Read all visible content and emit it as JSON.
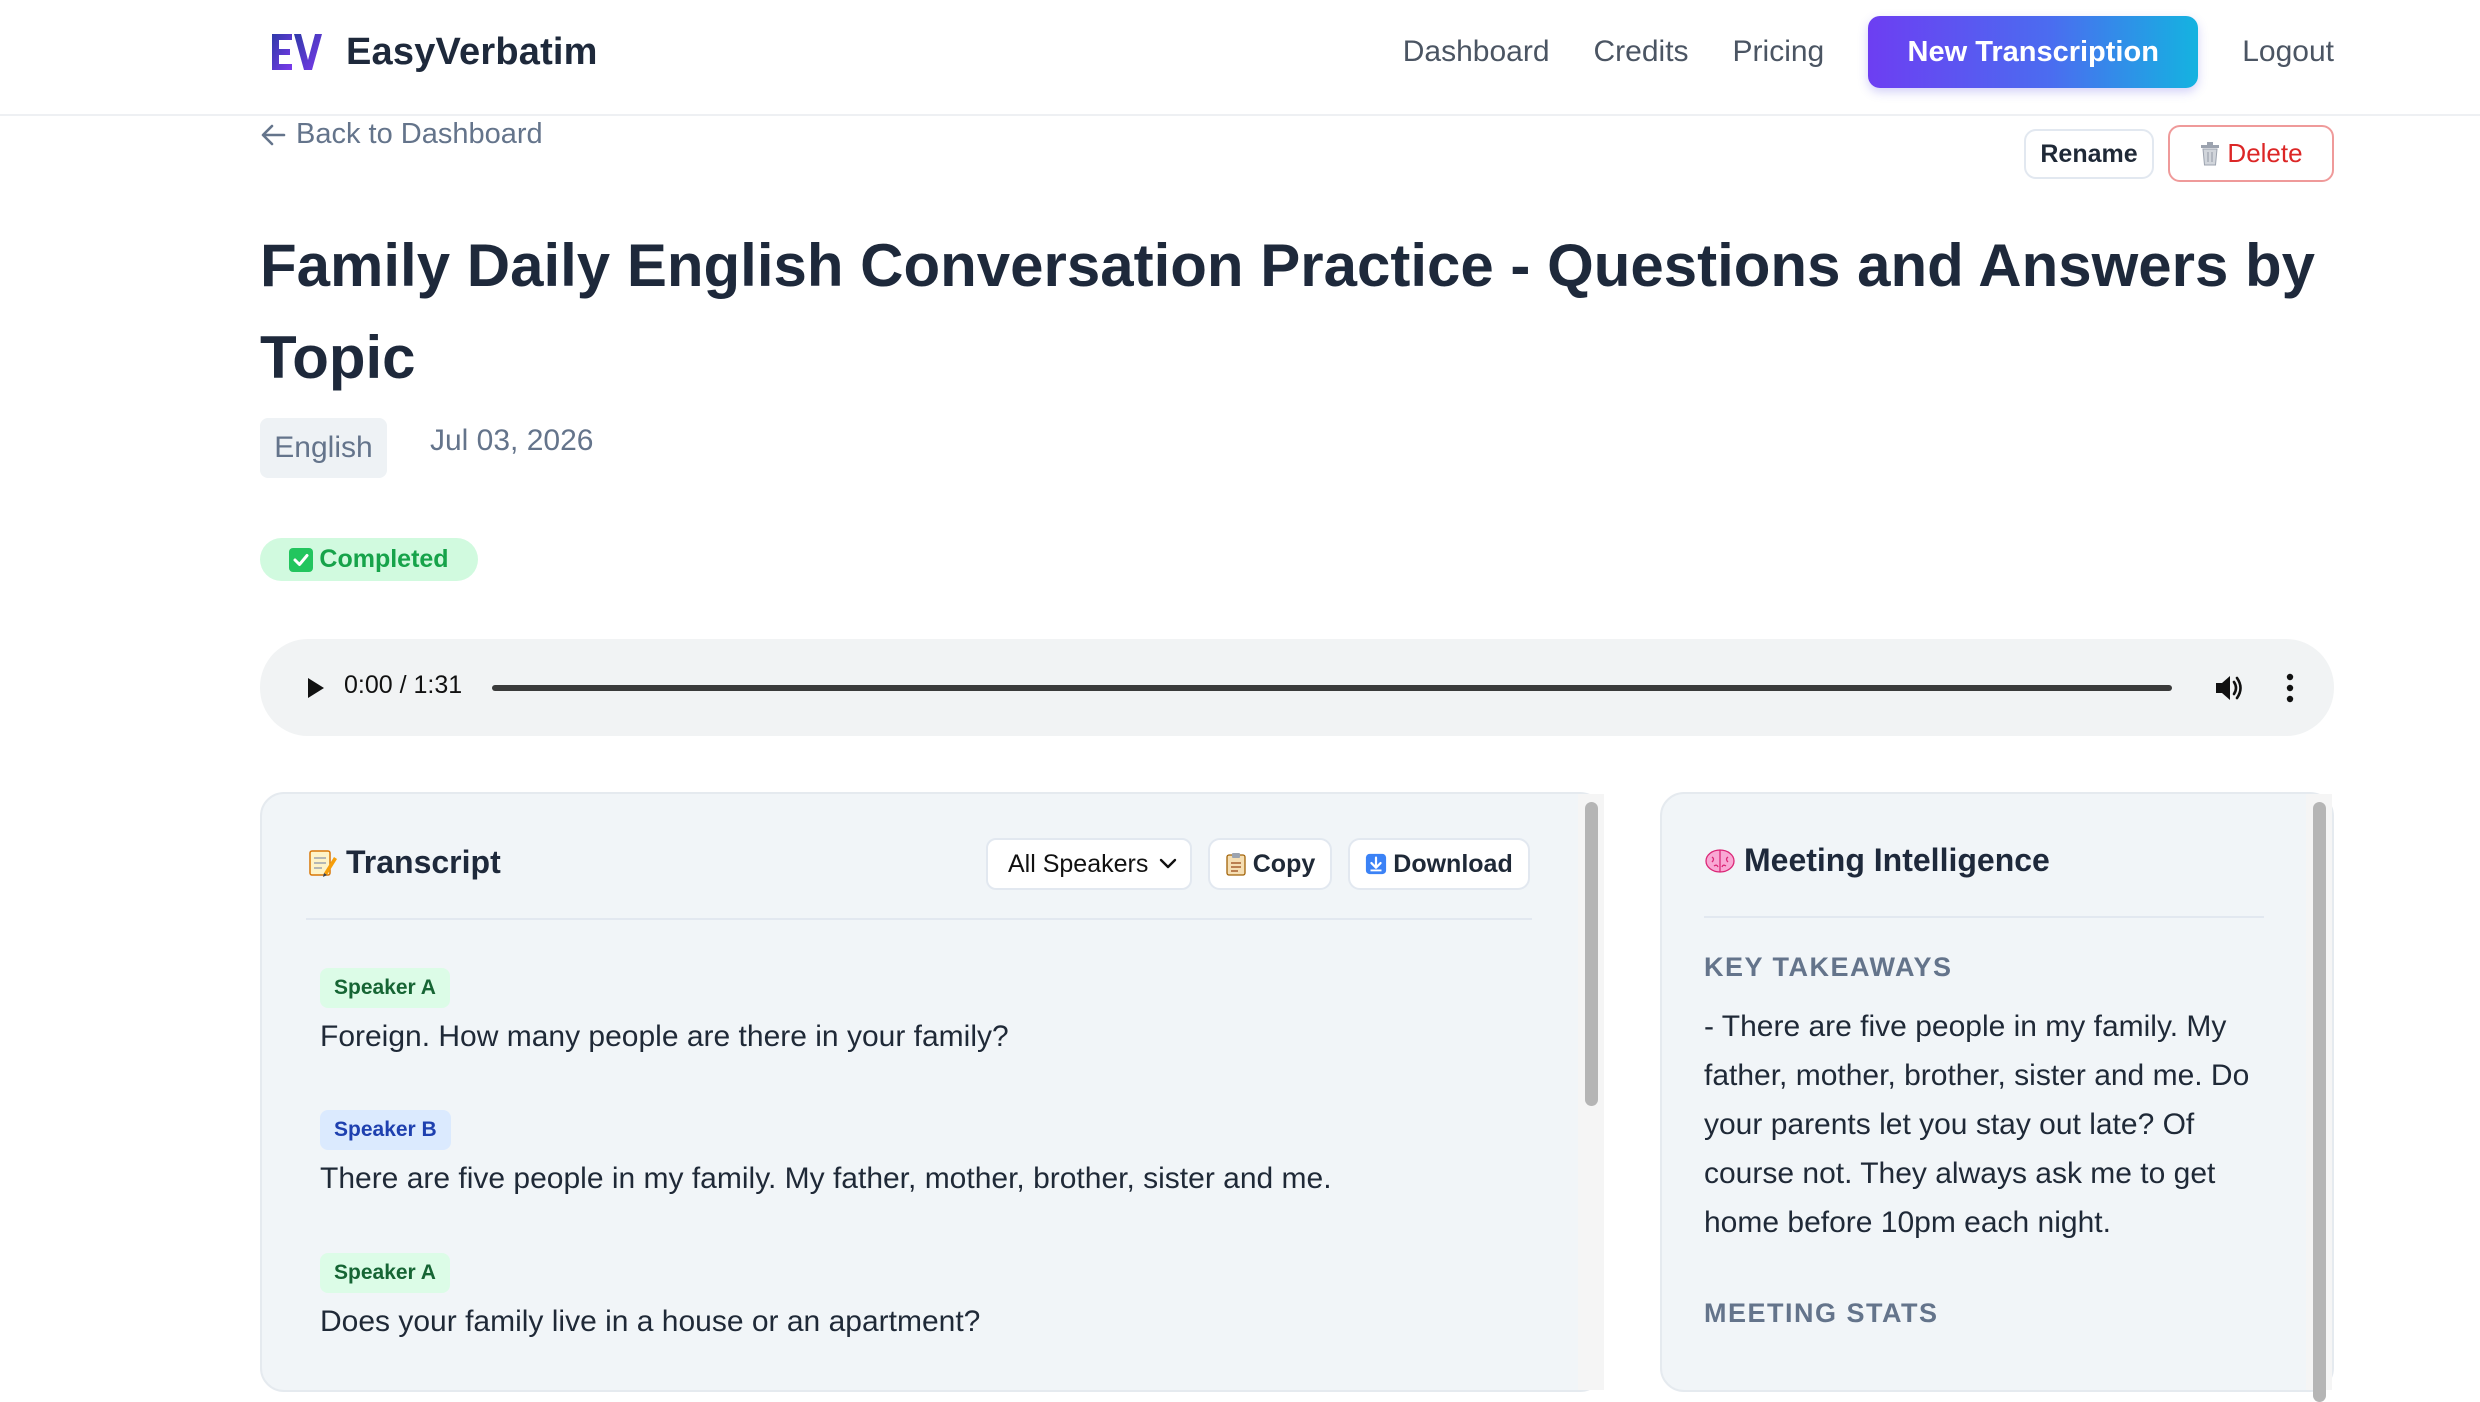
{
  "brand": {
    "logo_text": "EV",
    "name": "EasyVerbatim"
  },
  "nav": {
    "links": [
      "Dashboard",
      "Credits",
      "Pricing"
    ],
    "cta": "New Transcription",
    "logout": "Logout"
  },
  "header": {
    "back_label": "Back to Dashboard",
    "rename_label": "Rename",
    "delete_label": "Delete",
    "title": "Family Daily English Conversation Practice - Questions and Answers by Topic",
    "language": "English",
    "date": "Jul 03, 2026",
    "status": "Completed"
  },
  "audio": {
    "time": "0:00 / 1:31",
    "progress": 0
  },
  "transcript": {
    "title": "Transcript",
    "filter_selected": "All Speakers",
    "copy_label": "Copy",
    "download_label": "Download",
    "entries": [
      {
        "speaker": "Speaker A",
        "text": "Foreign. How many people are there in your family?"
      },
      {
        "speaker": "Speaker B",
        "text": "There are five people in my family. My father, mother, brother, sister and me."
      },
      {
        "speaker": "Speaker A",
        "text": "Does your family live in a house or an apartment?"
      }
    ]
  },
  "intelligence": {
    "title": "Meeting Intelligence",
    "takeaways_label": "KEY TAKEAWAYS",
    "takeaways_text": "- There are five people in my family. My father, mother, brother, sister and me. Do your parents let you stay out late? Of course not. They always ask me to get home before 10pm each night.",
    "stats_label": "MEETING STATS"
  },
  "colors": {
    "accent_start": "#6d3ef2",
    "accent_end": "#14b3e0",
    "status_green": "#16a34a",
    "delete_red": "#dc2626"
  },
  "icons": [
    "ev-logo",
    "arrow-left-icon",
    "trash-icon",
    "check-icon",
    "play-icon",
    "volume-icon",
    "more-vertical-icon",
    "memo-icon",
    "clipboard-icon",
    "download-icon",
    "brain-icon",
    "chevron-down-icon"
  ]
}
